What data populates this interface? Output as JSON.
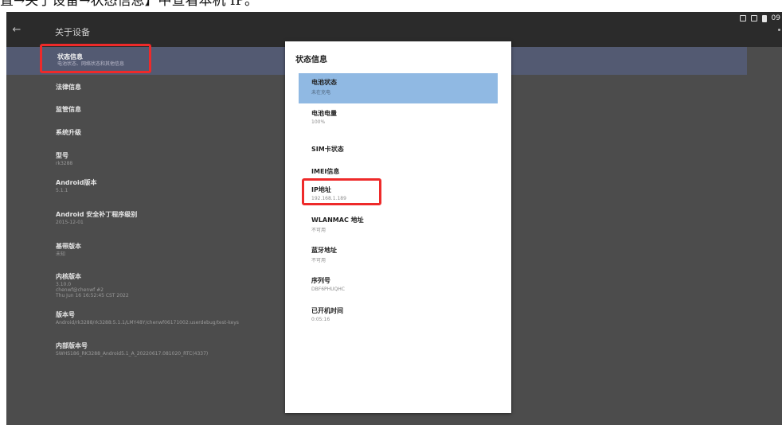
{
  "caption": "置→关于设备→状态信息】中查看本机 IP。",
  "appbar": {
    "title": "关于设备"
  },
  "settings": {
    "items": [
      {
        "title": "状态信息",
        "subtitle": "电池状态、网络状态和其他信息"
      },
      {
        "title": "法律信息",
        "subtitle": ""
      },
      {
        "title": "监管信息",
        "subtitle": ""
      },
      {
        "title": "系统升级",
        "subtitle": ""
      },
      {
        "title": "型号",
        "subtitle": "rk3288"
      },
      {
        "title": "Android版本",
        "subtitle": "5.1.1"
      },
      {
        "title": "Android 安全补丁程序级别",
        "subtitle": "2015-12-01"
      },
      {
        "title": "基带版本",
        "subtitle": "未知"
      },
      {
        "title": "内核版本",
        "subtitle": "3.10.0",
        "subtitle2": "chenwf@chenwf #2",
        "subtitle3": "Thu Jun 16 16:52:45 CST 2022"
      },
      {
        "title": "版本号",
        "subtitle": "Android/rk3288/rk3288:5.1.1/LMY48Y/chenwf06171002:userdebug/test-keys"
      },
      {
        "title": "内部版本号",
        "subtitle": "SWHS186_RK3288_Android5.1_A_20220617.081020_RTC(4337)"
      }
    ]
  },
  "dialog": {
    "title": "状态信息",
    "items": [
      {
        "title": "电池状态",
        "value": "未在充电"
      },
      {
        "title": "电池电量",
        "value": "100%"
      },
      {
        "title": "SIM卡状态",
        "value": ""
      },
      {
        "title": "IMEI信息",
        "value": ""
      },
      {
        "title": "IP地址",
        "value": "192.168.1.189"
      },
      {
        "title": "WLANMAC 地址",
        "value": "不可用"
      },
      {
        "title": "蓝牙地址",
        "value": "不可用"
      },
      {
        "title": "序列号",
        "value": "DBF6PHUQHC"
      },
      {
        "title": "已开机时间",
        "value": "0:05:16"
      }
    ]
  },
  "statusbar": {
    "time": "09"
  },
  "colors": {
    "highlight": "#90b9e3",
    "annotation": "#ee2a2a",
    "selected_row": "#535a72"
  }
}
